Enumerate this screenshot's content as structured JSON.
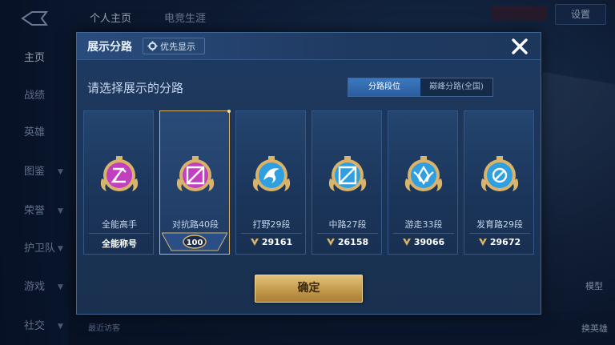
{
  "background": {
    "tabs": [
      "个人主页",
      "电竞生涯"
    ],
    "sidebar": [
      {
        "label": "主页",
        "caret": false
      },
      {
        "label": "战绩",
        "caret": false
      },
      {
        "label": "英雄",
        "caret": false
      },
      {
        "label": "图鉴",
        "caret": true
      },
      {
        "label": "荣誉",
        "caret": true
      },
      {
        "label": "护卫队",
        "caret": true
      },
      {
        "label": "游戏",
        "caret": true
      },
      {
        "label": "社交",
        "caret": true
      }
    ],
    "settings_label": "设置",
    "right_labels": [
      "模型",
      "换英雄"
    ],
    "recent_visitors": "最近访客"
  },
  "modal": {
    "title": "展示分路",
    "priority_label": "优先显示",
    "prompt": "请选择展示的分路",
    "segments": [
      {
        "label": "分路段位",
        "active": true
      },
      {
        "label": "巅峰分路(全国)",
        "active": false
      }
    ],
    "cards": [
      {
        "name": "全能高手",
        "stat": "全能称号",
        "emblem": "all-round-emblem",
        "color": "#c23fc0",
        "selected": false,
        "has_icon": false
      },
      {
        "name": "对抗路40段",
        "stat": "100",
        "emblem": "clash-lane-emblem",
        "color": "#c23fc0",
        "selected": true,
        "has_icon": false
      },
      {
        "name": "打野29段",
        "stat": "29161",
        "emblem": "jungle-emblem",
        "color": "#2f9fe0",
        "selected": false,
        "has_icon": true
      },
      {
        "name": "中路27段",
        "stat": "26158",
        "emblem": "mid-lane-emblem",
        "color": "#2f9fe0",
        "selected": false,
        "has_icon": true
      },
      {
        "name": "游走33段",
        "stat": "39066",
        "emblem": "roam-emblem",
        "color": "#2f9fe0",
        "selected": false,
        "has_icon": true
      },
      {
        "name": "发育路29段",
        "stat": "29672",
        "emblem": "farm-lane-emblem",
        "color": "#2f9fe0",
        "selected": false,
        "has_icon": true
      }
    ],
    "confirm_label": "确定"
  },
  "colors": {
    "gold": "#d9b36a",
    "accent_blue": "#2b5d9e",
    "purple_emblem": "#c23fc0",
    "blue_emblem": "#2f9fe0"
  }
}
